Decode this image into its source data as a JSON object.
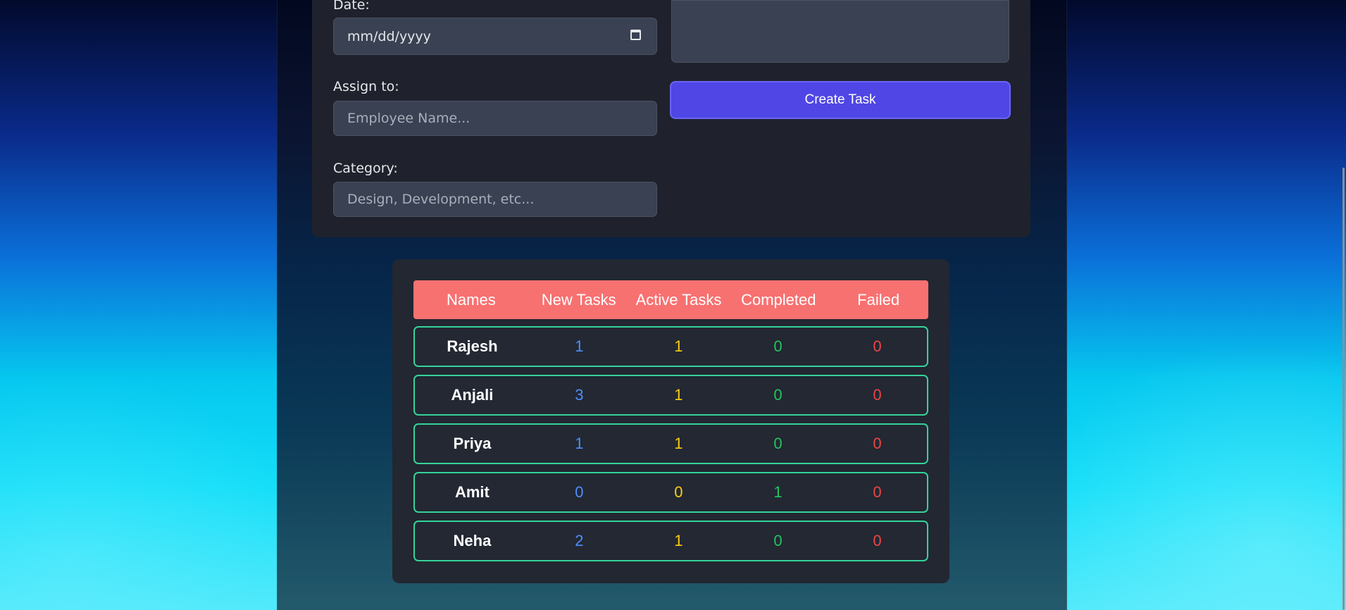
{
  "form": {
    "date_label": "Date:",
    "date_value": "mm/dd/yyyy",
    "assign_label": "Assign to:",
    "assign_placeholder": "Employee Name...",
    "category_label": "Category:",
    "category_placeholder": "Design, Development, etc...",
    "create_button": "Create Task"
  },
  "table": {
    "headers": [
      "Names",
      "New Tasks",
      "Active Tasks",
      "Completed",
      "Failed"
    ],
    "rows": [
      {
        "name": "Rajesh",
        "new": "1",
        "active": "1",
        "completed": "0",
        "failed": "0"
      },
      {
        "name": "Anjali",
        "new": "3",
        "active": "1",
        "completed": "0",
        "failed": "0"
      },
      {
        "name": "Priya",
        "new": "1",
        "active": "1",
        "completed": "0",
        "failed": "0"
      },
      {
        "name": "Amit",
        "new": "0",
        "active": "0",
        "completed": "1",
        "failed": "0"
      },
      {
        "name": "Neha",
        "new": "2",
        "active": "1",
        "completed": "0",
        "failed": "0"
      }
    ]
  },
  "colors": {
    "accent": "#4f46e5",
    "header": "#f87171",
    "row_border": "#34d399",
    "new": "#4f8ef7",
    "active": "#facc15",
    "completed": "#22c55e",
    "failed": "#ef4444"
  }
}
